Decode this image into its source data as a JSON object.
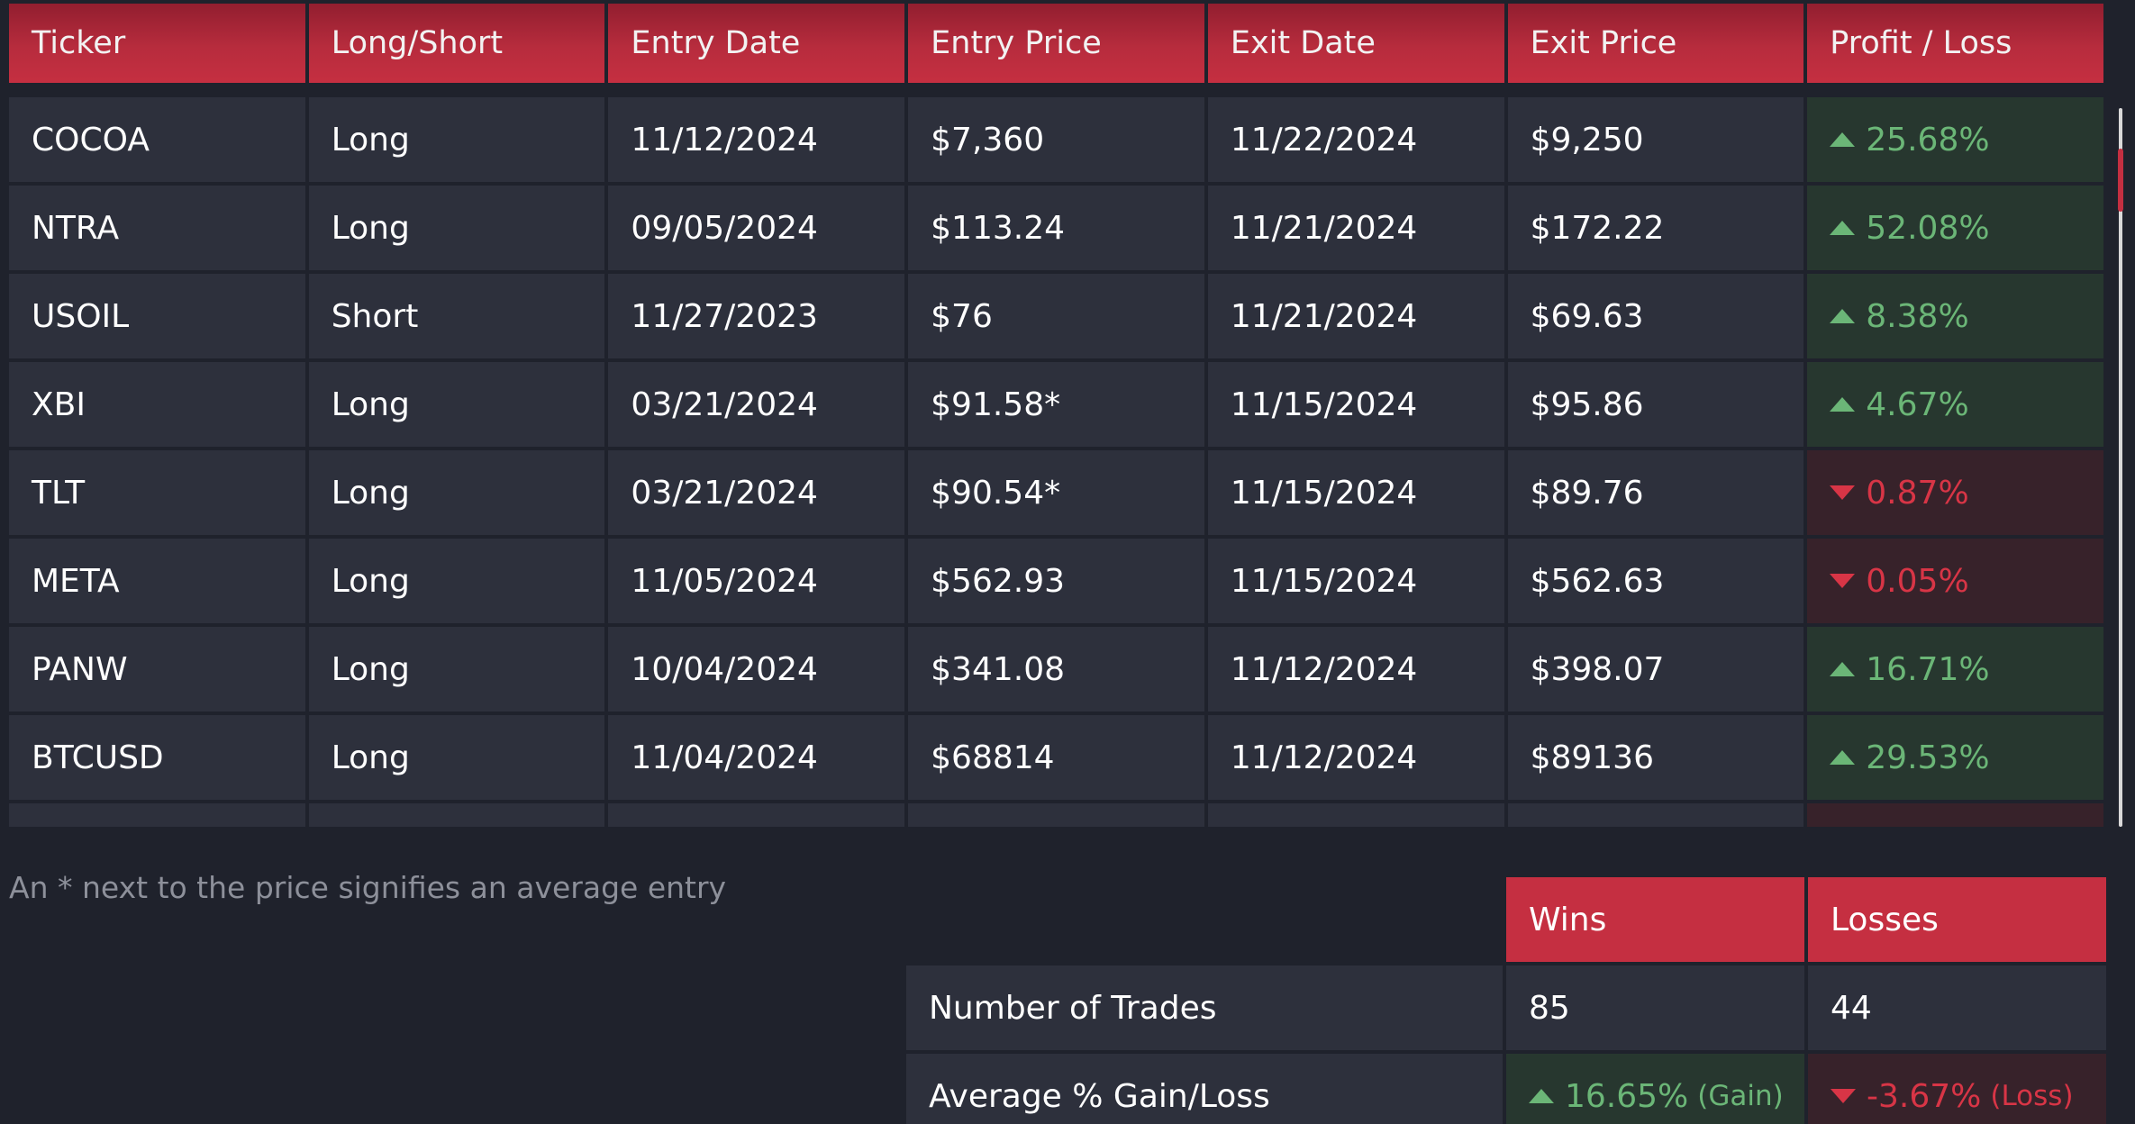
{
  "table": {
    "headers": [
      "Ticker",
      "Long/Short",
      "Entry Date",
      "Entry Price",
      "Exit Date",
      "Exit Price",
      "Profit / Loss"
    ],
    "rows": [
      {
        "ticker": "COCOA",
        "side": "Long",
        "entry_date": "11/12/2024",
        "entry_price": "$7,360",
        "exit_date": "11/22/2024",
        "exit_price": "$9,250",
        "pl": "25.68%",
        "pl_dir": "gain"
      },
      {
        "ticker": "NTRA",
        "side": "Long",
        "entry_date": "09/05/2024",
        "entry_price": "$113.24",
        "exit_date": "11/21/2024",
        "exit_price": "$172.22",
        "pl": "52.08%",
        "pl_dir": "gain"
      },
      {
        "ticker": "USOIL",
        "side": "Short",
        "entry_date": "11/27/2023",
        "entry_price": "$76",
        "exit_date": "11/21/2024",
        "exit_price": "$69.63",
        "pl": "8.38%",
        "pl_dir": "gain"
      },
      {
        "ticker": "XBI",
        "side": "Long",
        "entry_date": "03/21/2024",
        "entry_price": "$91.58*",
        "exit_date": "11/15/2024",
        "exit_price": "$95.86",
        "pl": "4.67%",
        "pl_dir": "gain"
      },
      {
        "ticker": "TLT",
        "side": "Long",
        "entry_date": "03/21/2024",
        "entry_price": "$90.54*",
        "exit_date": "11/15/2024",
        "exit_price": "$89.76",
        "pl": "0.87%",
        "pl_dir": "loss"
      },
      {
        "ticker": "META",
        "side": "Long",
        "entry_date": "11/05/2024",
        "entry_price": "$562.93",
        "exit_date": "11/15/2024",
        "exit_price": "$562.63",
        "pl": "0.05%",
        "pl_dir": "loss"
      },
      {
        "ticker": "PANW",
        "side": "Long",
        "entry_date": "10/04/2024",
        "entry_price": "$341.08",
        "exit_date": "11/12/2024",
        "exit_price": "$398.07",
        "pl": "16.71%",
        "pl_dir": "gain"
      },
      {
        "ticker": "BTCUSD",
        "side": "Long",
        "entry_date": "11/04/2024",
        "entry_price": "$68814",
        "exit_date": "11/12/2024",
        "exit_price": "$89136",
        "pl": "29.53%",
        "pl_dir": "gain"
      },
      {
        "ticker": "",
        "side": "",
        "entry_date": "",
        "entry_price": "",
        "exit_date": "",
        "exit_price": "",
        "pl": "",
        "pl_dir": "loss"
      }
    ]
  },
  "footnote": "An * next to the price signifies an average entry",
  "summary": {
    "headers": {
      "wins": "Wins",
      "losses": "Losses"
    },
    "rows": [
      {
        "label": "Number of Trades",
        "wins": "85",
        "losses": "44"
      },
      {
        "label": "Average % Gain/Loss",
        "wins": "16.65%",
        "wins_suffix": "(Gain)",
        "losses": "-3.67%",
        "losses_suffix": "(Loss)"
      }
    ]
  },
  "colors": {
    "header_red": "#c52f41",
    "gain_green": "#6bb677",
    "loss_red": "#d83546",
    "cell_bg": "#2d303c",
    "page_bg": "#1f222c"
  }
}
